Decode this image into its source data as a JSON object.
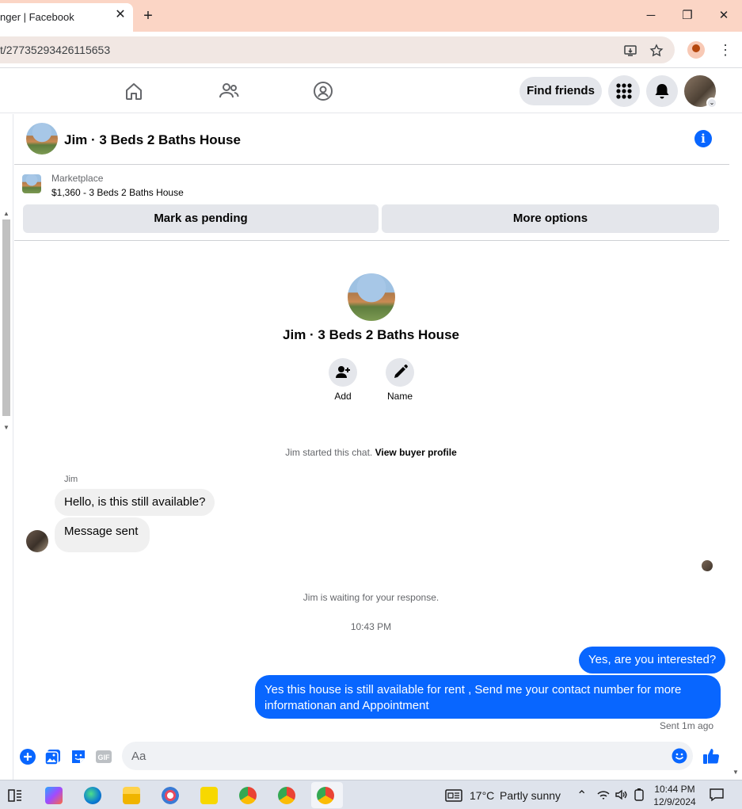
{
  "browser": {
    "tab_title": "nger | Facebook",
    "tab_close": "✕",
    "new_tab": "+",
    "url": "t/27735293426115653",
    "window_controls": {
      "minimize": "─",
      "restore": "❐",
      "close": "✕"
    }
  },
  "fb_nav": {
    "find_friends": "Find friends",
    "icons": [
      "home-icon",
      "friends-icon",
      "groups-icon",
      "menu-grid-icon",
      "notifications-bell-icon"
    ]
  },
  "chat": {
    "header_name": "Jim · 3 Beds 2 Baths House",
    "marketplace_label": "Marketplace",
    "listing": "$1,360 - 3 Beds 2 Baths House",
    "mark_pending": "Mark as pending",
    "more_options": "More options",
    "intro_name": "Jim · 3 Beds 2 Baths House",
    "add_label": "Add",
    "name_label": "Name",
    "started_text": "Jim started this chat.",
    "view_buyer_profile": "View buyer profile",
    "sender_name": "Jim",
    "messages_in": [
      "Hello, is this still available?",
      "Message sent"
    ],
    "waiting_text": "Jim is waiting for your response.",
    "time_divider": "10:43 PM",
    "messages_out": [
      "Yes, are you interested?",
      "Yes this house is still available for rent , Send me your contact number for more informationan and Appointment"
    ],
    "sent_status": "Sent 1m ago",
    "composer_placeholder": "Aa"
  },
  "taskbar": {
    "weather_temp": "17°C",
    "weather_text": "Partly sunny",
    "time": "10:44 PM",
    "date": "12/9/2024"
  },
  "colors": {
    "messenger_blue": "#0866ff",
    "bubble_grey": "#f0f0f0",
    "tab_strip": "#fbd5c5"
  }
}
